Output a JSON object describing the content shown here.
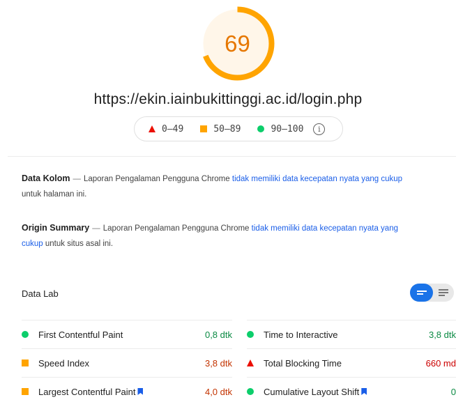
{
  "score": {
    "value": "69",
    "fraction": 0.69,
    "color": "#ffa400",
    "text_color": "#e67700"
  },
  "page_url": "https://ekin.iainbukittinggi.ac.id/login.php",
  "legend": {
    "fail": "0–49",
    "average": "50–89",
    "pass": "90–100",
    "info_icon": "info-icon"
  },
  "field_data": {
    "heading": "Data Kolom",
    "dash": "—",
    "text_before": "Laporan Pengalaman Pengguna Chrome",
    "link": "tidak memiliki data kecepatan nyata yang cukup",
    "text_after": "untuk halaman ini."
  },
  "origin_summary": {
    "heading": "Origin Summary",
    "dash": "—",
    "text_before": "Laporan Pengalaman Pengguna Chrome",
    "link": "tidak memiliki data kecepatan nyata yang cukup",
    "text_after": "untuk situs asal ini."
  },
  "lab_data": {
    "heading": "Data Lab",
    "toggle_icons": [
      "list-view-icon",
      "text-view-icon"
    ],
    "metrics": [
      {
        "label": "First Contentful Paint",
        "value": "0,8 dtk",
        "status": "pass",
        "flag": false
      },
      {
        "label": "Time to Interactive",
        "value": "3,8 dtk",
        "status": "pass",
        "flag": false
      },
      {
        "label": "Speed Index",
        "value": "3,8 dtk",
        "status": "average",
        "flag": false
      },
      {
        "label": "Total Blocking Time",
        "value": "660 md",
        "status": "fail",
        "flag": false
      },
      {
        "label": "Largest Contentful Paint",
        "value": "4,0 dtk",
        "status": "average",
        "flag": true
      },
      {
        "label": "Cumulative Layout Shift",
        "value": "0",
        "status": "pass",
        "flag": true
      }
    ]
  },
  "colors": {
    "pass": "#0cce6b",
    "average": "#ffa400",
    "fail": "#eb0f00",
    "link": "#1a5ee8",
    "toggle_active": "#1a73e8"
  }
}
